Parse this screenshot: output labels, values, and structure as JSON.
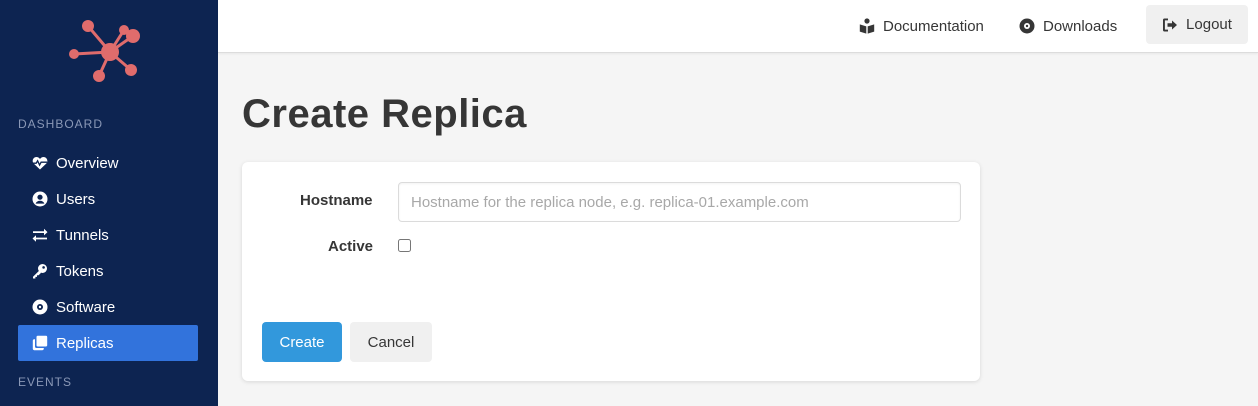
{
  "sidebar": {
    "section_dashboard": "DASHBOARD",
    "section_events": "EVENTS",
    "items": [
      {
        "label": "Overview",
        "icon": "heartbeat-icon"
      },
      {
        "label": "Users",
        "icon": "user-circle-icon"
      },
      {
        "label": "Tunnels",
        "icon": "exchange-icon"
      },
      {
        "label": "Tokens",
        "icon": "key-icon"
      },
      {
        "label": "Software",
        "icon": "disc-icon"
      },
      {
        "label": "Replicas",
        "icon": "clone-icon",
        "active": true
      }
    ]
  },
  "topbar": {
    "documentation_label": "Documentation",
    "downloads_label": "Downloads",
    "logout_label": "Logout"
  },
  "page": {
    "title": "Create Replica"
  },
  "form": {
    "hostname_label": "Hostname",
    "hostname_value": "",
    "hostname_placeholder": "Hostname for the replica node, e.g. replica-01.example.com",
    "active_label": "Active",
    "active_checked": false,
    "create_label": "Create",
    "cancel_label": "Cancel"
  },
  "colors": {
    "sidebar_bg": "#0d2451",
    "accent": "#3273dc",
    "primary_button": "#3298dc",
    "logo": "#e06c6c"
  }
}
